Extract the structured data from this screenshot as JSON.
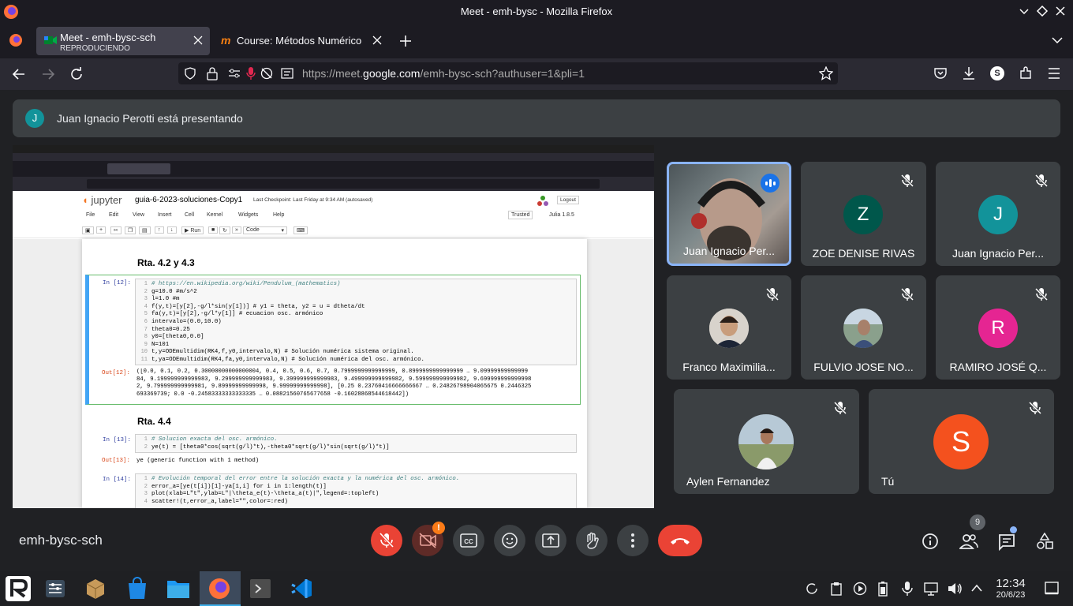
{
  "window": {
    "title": "Meet - emh-bysc - Mozilla Firefox"
  },
  "tabs": [
    {
      "title": "Meet - emh-bysc-sch",
      "subtitle": "REPRODUCIENDO",
      "active": true
    },
    {
      "title": "Course: Métodos Numérico",
      "active": false
    }
  ],
  "urlbar": {
    "prefix": "https://meet.",
    "domain": "google.com",
    "rest": "/emh-bysc-sch?authuser=1&pli=1"
  },
  "banner": {
    "initial": "J",
    "text": "Juan Ignacio Perotti está presentando"
  },
  "jupyter": {
    "logo": "jupyter",
    "notebook": "guia-6-2023-soluciones-Copy1",
    "checkpoint": "Last Checkpoint: Last Friday at 9:34 AM  (autosaved)",
    "logout": "Logout",
    "trusted": "Trusted",
    "kernel": "Julia 1.8.5",
    "menu": [
      "File",
      "Edit",
      "View",
      "Insert",
      "Cell",
      "Kernel",
      "Widgets",
      "Help"
    ],
    "run": "Run",
    "celltype": "Code",
    "h1": "Rta. 4.2 y 4.3",
    "h2": "Rta. 4.4",
    "in12": "In [12]:",
    "out12": "Out[12]:",
    "in13": "In [13]:",
    "out13": "Out[13]:",
    "in14": "In [14]:",
    "code12": [
      "# https://en.wikipedia.org/wiki/Pendulum_(mathematics)",
      "g=10.0 #m/s^2",
      "l=1.0 #m",
      "f(y,t)=[y[2],-g/l*sin(y[1])] # y1 = theta, y2 = u = dtheta/dt",
      "fa(y,t)=[y[2],-g/l*y[1]] # ecuacion osc. armónico",
      "intervalo=(0.0,10.0)",
      "theta0=0.25",
      "y0=[theta0,0.0]",
      "N=101",
      "t,y=ODEmultidim(RK4,f,y0,intervalo,N)   # Solución numérica sistema original.",
      "t,ya=ODEmultidim(RK4,fa,y0,intervalo,N) # Solución numérica del osc. armónico."
    ],
    "output12": [
      "([0.0, 0.1, 0.2, 0.30000000000000004, 0.4, 0.5, 0.6, 0.7, 0.7999999999999999, 0.8999999999999999  …  9.09999999999999",
      "84, 9.199999999999983, 9.299999999999983, 9.399999999999983, 9.499999999999982, 9.599999999999982, 9.699999999999998",
      "2, 9.799999999999981, 9.89999999999998, 9.99999999999998], [0.25 0.23760416666666667 … 0.24826798904065675 0.2446325",
      "693369739; 0.0 -0.24583333333333335 … 0.08821560765677658 -0.16028868544618442])"
    ],
    "code13": [
      "# Solucion exacta del osc. armónico.",
      "ye(t) = [theta0*cos(sqrt(g/l)*t),-theta0*sqrt(g/l)*sin(sqrt(g/l)*t)]"
    ],
    "output13": "ye (generic function with 1 method)",
    "code14": [
      "# Evolución temporal del error entre la solución exacta y la numérica del osc. armónico.",
      "error_a=[ye(t[i])[1]-ya[1,i] for i in 1:length(t)]",
      "plot(xlab=L\"t\",ylab=L\"|\\theta_e(t)-\\theta_a(t)|\",legend=:topleft)",
      "scatter!(t,error_a,label=\"\",color=:red)"
    ]
  },
  "participants": [
    {
      "name": "Juan Ignacio Per...",
      "type": "video",
      "speaking": true
    },
    {
      "name": "ZOE DENISE RIVAS",
      "initial": "Z",
      "color": "#00574b",
      "muted": true
    },
    {
      "name": "Juan Ignacio Per...",
      "initial": "J",
      "color": "#12939a",
      "muted": true
    },
    {
      "name": "Franco Maximilia...",
      "type": "photo",
      "muted": true
    },
    {
      "name": "FULVIO JOSE NO...",
      "type": "photo",
      "muted": true
    },
    {
      "name": "RAMIRO JOSÉ Q...",
      "initial": "R",
      "color": "#e52592",
      "muted": true
    },
    {
      "name": "Aylen Fernandez",
      "type": "photo",
      "muted": true
    },
    {
      "name": "Tú",
      "initial": "S",
      "color": "#f4511e",
      "muted": true
    }
  ],
  "meeting_code": "emh-bysc-sch",
  "people_count": "9",
  "clock": {
    "time": "12:34",
    "date": "20/6/23"
  },
  "colors": {
    "end_call": "#ea4335",
    "mute_red": "#ea4335",
    "bg": "#202124"
  }
}
